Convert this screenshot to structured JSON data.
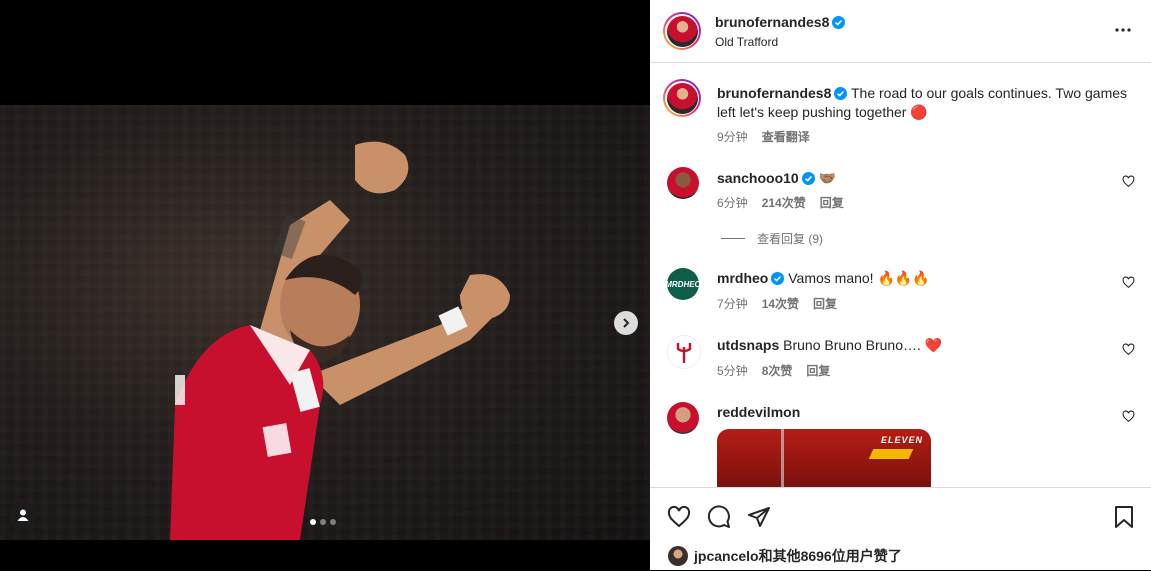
{
  "post": {
    "author": "brunofernandes8",
    "location": "Old Trafford",
    "caption": "The road to our goals continues. Two games left let's keep pushing together",
    "caption_emoji": "🔴",
    "time": "9分钟",
    "translate_label": "查看翻译"
  },
  "media": {
    "slide_count": 3,
    "active_slide": 1
  },
  "comments": [
    {
      "user": "sanchooo10",
      "verified": true,
      "text": "🤝🏽",
      "time": "6分钟",
      "likes": "214次赞",
      "reply_label": "回复",
      "view_replies": "查看回复 (9)"
    },
    {
      "user": "mrdheo",
      "verified": true,
      "text": "Vamos mano! 🔥🔥🔥",
      "time": "7分钟",
      "likes": "14次赞",
      "reply_label": "回复"
    },
    {
      "user": "utdsnaps",
      "verified": false,
      "text": "Bruno Bruno Bruno…. ❤️",
      "time": "5分钟",
      "likes": "8次赞",
      "reply_label": "回复"
    },
    {
      "user": "reddevilmon",
      "verified": false,
      "text": "",
      "gif_label": "ELEVEN"
    }
  ],
  "footer": {
    "likes_text": "jpcancelo和其他8696位用户赞了"
  },
  "colors": {
    "verified": "#0095f6",
    "accent_red": "#c8102e"
  },
  "icons": {
    "like": "heart-icon",
    "comment": "comment-icon",
    "share": "share-icon",
    "save": "bookmark-icon",
    "more": "more-horizontal-icon",
    "next": "chevron-right-icon",
    "tag": "user-tag-icon"
  }
}
